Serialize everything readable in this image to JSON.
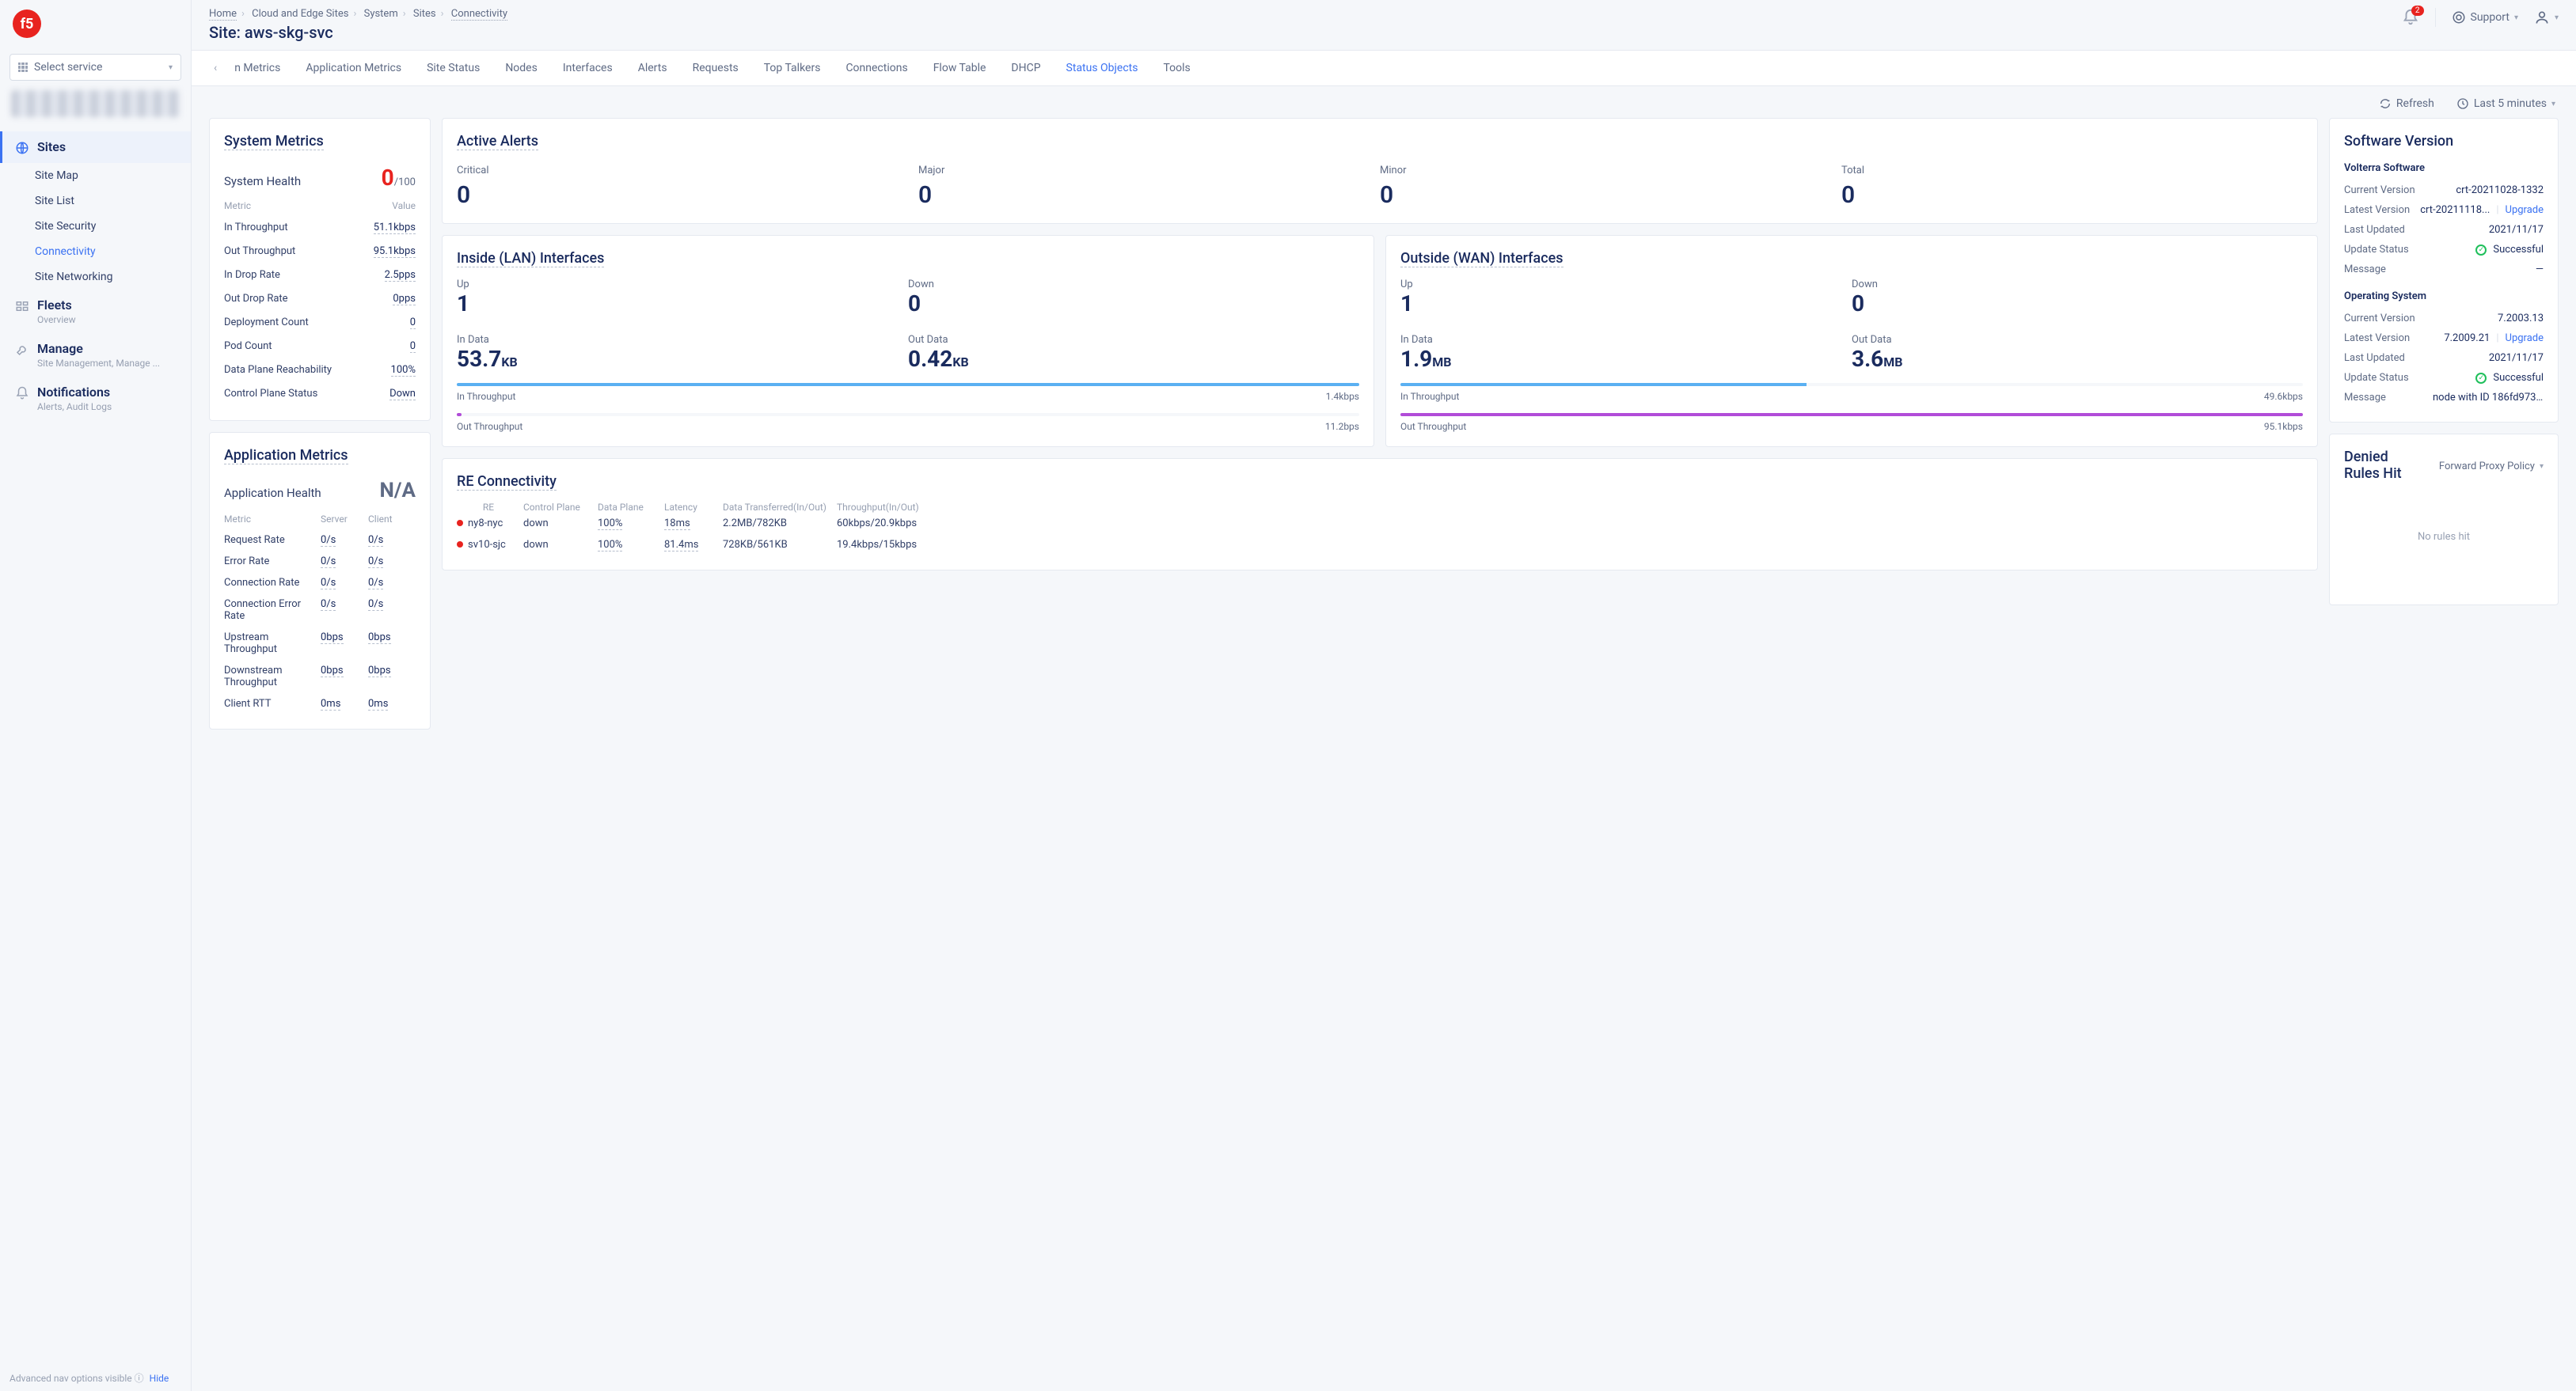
{
  "brand": "f5",
  "service_selector": "Select service",
  "breadcrumb": [
    "Home",
    "Cloud and Edge Sites",
    "System",
    "Sites",
    "Connectivity"
  ],
  "page_title": "Site: aws-skg-svc",
  "notifications_count": "2",
  "support_label": "Support",
  "sidebar": {
    "sites": {
      "label": "Sites",
      "items": [
        "Site Map",
        "Site List",
        "Site Security",
        "Connectivity",
        "Site Networking"
      ],
      "active": "Connectivity"
    },
    "fleets": {
      "label": "Fleets",
      "desc": "Overview"
    },
    "manage": {
      "label": "Manage",
      "desc": "Site Management, Manage ..."
    },
    "notifs": {
      "label": "Notifications",
      "desc": "Alerts, Audit Logs"
    },
    "adv_text": "Advanced nav options visible",
    "adv_link": "Hide"
  },
  "tabs": {
    "items": [
      "n Metrics",
      "Application Metrics",
      "Site Status",
      "Nodes",
      "Interfaces",
      "Alerts",
      "Requests",
      "Top Talkers",
      "Connections",
      "Flow Table",
      "DHCP",
      "Status Objects",
      "Tools"
    ],
    "selected": "Status Objects"
  },
  "toolbar": {
    "refresh": "Refresh",
    "range": "Last 5 minutes"
  },
  "system_metrics": {
    "title": "System Metrics",
    "health_label": "System Health",
    "health_value": "0",
    "health_suffix": "/100",
    "head_metric": "Metric",
    "head_value": "Value",
    "rows": [
      {
        "k": "In Throughput",
        "v": "51.1kbps"
      },
      {
        "k": "Out Throughput",
        "v": "95.1kbps"
      },
      {
        "k": "In Drop Rate",
        "v": "2.5pps"
      },
      {
        "k": "Out Drop Rate",
        "v": "0pps"
      },
      {
        "k": "Deployment Count",
        "v": "0"
      },
      {
        "k": "Pod Count",
        "v": "0"
      },
      {
        "k": "Data Plane Reachability",
        "v": "100%"
      },
      {
        "k": "Control Plane Status",
        "v": "Down"
      }
    ]
  },
  "app_metrics": {
    "title": "Application Metrics",
    "health_label": "Application Health",
    "health_value": "N/A",
    "head_metric": "Metric",
    "head_server": "Server",
    "head_client": "Client",
    "rows": [
      {
        "k": "Request Rate",
        "s": "0/s",
        "c": "0/s"
      },
      {
        "k": "Error Rate",
        "s": "0/s",
        "c": "0/s"
      },
      {
        "k": "Connection Rate",
        "s": "0/s",
        "c": "0/s"
      },
      {
        "k": "Connection Error Rate",
        "s": "0/s",
        "c": "0/s"
      },
      {
        "k": "Upstream Throughput",
        "s": "0bps",
        "c": "0bps"
      },
      {
        "k": "Downstream Throughput",
        "s": "0bps",
        "c": "0bps"
      },
      {
        "k": "Client RTT",
        "s": "0ms",
        "c": "0ms"
      }
    ]
  },
  "alerts": {
    "title": "Active Alerts",
    "items": [
      {
        "l": "Critical",
        "n": "0"
      },
      {
        "l": "Major",
        "n": "0"
      },
      {
        "l": "Minor",
        "n": "0"
      },
      {
        "l": "Total",
        "n": "0"
      }
    ]
  },
  "lan": {
    "title": "Inside (LAN) Interfaces",
    "up_l": "Up",
    "up": "1",
    "down_l": "Down",
    "down": "0",
    "in_l": "In Data",
    "in": "53.7",
    "in_u": "KB",
    "out_l": "Out Data",
    "out": "0.42",
    "out_u": "KB",
    "in_thr_l": "In Throughput",
    "in_thr": "1.4kbps",
    "out_thr_l": "Out Throughput",
    "out_thr": "11.2bps"
  },
  "wan": {
    "title": "Outside (WAN) Interfaces",
    "up_l": "Up",
    "up": "1",
    "down_l": "Down",
    "down": "0",
    "in_l": "In Data",
    "in": "1.9",
    "in_u": "MB",
    "out_l": "Out Data",
    "out": "3.6",
    "out_u": "MB",
    "in_thr_l": "In Throughput",
    "in_thr": "49.6kbps",
    "out_thr_l": "Out Throughput",
    "out_thr": "95.1kbps"
  },
  "re": {
    "title": "RE Connectivity",
    "head": [
      "RE",
      "Control Plane",
      "Data Plane",
      "Latency",
      "Data Transferred(In/Out)",
      "Throughput(In/Out)"
    ],
    "rows": [
      {
        "re": "ny8-nyc",
        "cp": "down",
        "dp": "100%",
        "lat": "18ms",
        "dt": "2.2MB/782KB",
        "tp": "60kbps/20.9kbps"
      },
      {
        "re": "sv10-sjc",
        "cp": "down",
        "dp": "100%",
        "lat": "81.4ms",
        "dt": "728KB/561KB",
        "tp": "19.4kbps/15kbps"
      }
    ]
  },
  "sw": {
    "title": "Software Version",
    "volterra": {
      "title": "Volterra Software",
      "rows": [
        {
          "k": "Current Version",
          "v": "crt-20211028-1332"
        },
        {
          "k": "Latest Version",
          "v": "crt-20211118...",
          "upgrade": "Upgrade"
        },
        {
          "k": "Last Updated",
          "v": "2021/11/17"
        },
        {
          "k": "Update Status",
          "v": "Successful",
          "ok": true
        },
        {
          "k": "Message",
          "v": "—"
        }
      ]
    },
    "os": {
      "title": "Operating System",
      "rows": [
        {
          "k": "Current Version",
          "v": "7.2003.13"
        },
        {
          "k": "Latest Version",
          "v": "7.2009.21",
          "upgrade": "Upgrade"
        },
        {
          "k": "Last Updated",
          "v": "2021/11/17"
        },
        {
          "k": "Update Status",
          "v": "Successful",
          "ok": true
        },
        {
          "k": "Message",
          "v": "node with ID 186fd973-0..."
        }
      ]
    }
  },
  "denied": {
    "title": "Denied Rules Hit",
    "selector": "Forward Proxy Policy",
    "empty": "No rules hit"
  }
}
